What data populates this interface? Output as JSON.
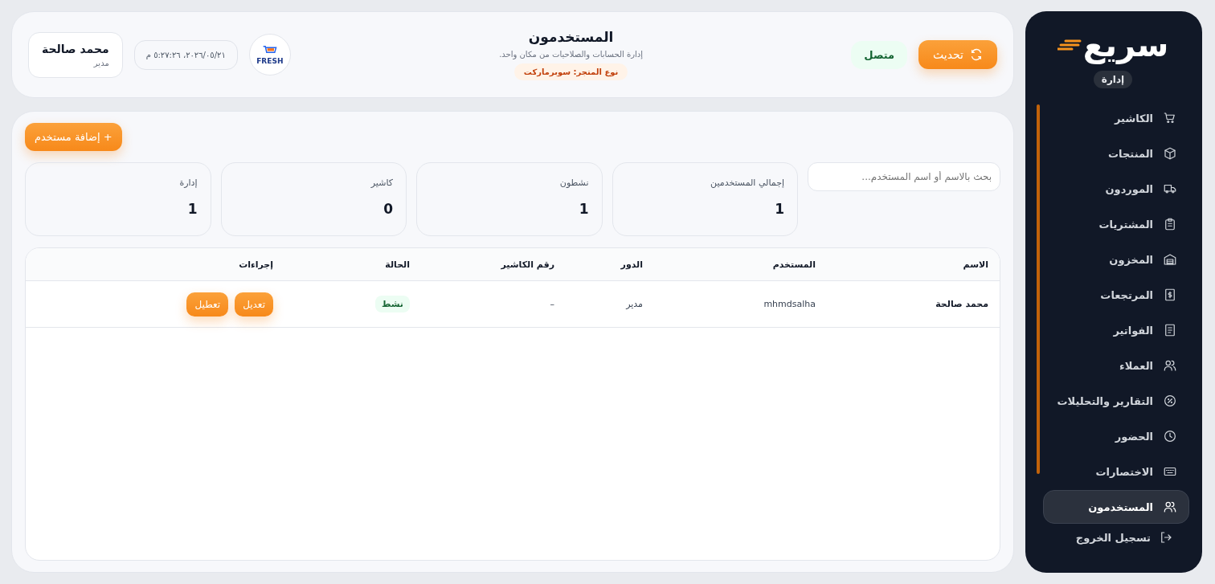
{
  "sidebar": {
    "logo": "سريع",
    "role_badge": "إدارة",
    "items": [
      {
        "label": "الكاشير",
        "selected": false
      },
      {
        "label": "المنتجات",
        "selected": false
      },
      {
        "label": "الموردون",
        "selected": false
      },
      {
        "label": "المشتريات",
        "selected": false
      },
      {
        "label": "المخزون",
        "selected": false
      },
      {
        "label": "المرتجعات",
        "selected": false
      },
      {
        "label": "الفواتير",
        "selected": false
      },
      {
        "label": "العملاء",
        "selected": false
      },
      {
        "label": "التقارير والتحليلات",
        "selected": false
      },
      {
        "label": "الحضور",
        "selected": false
      },
      {
        "label": "الاختصارات",
        "selected": false
      },
      {
        "label": "المستخدمون",
        "selected": true
      }
    ],
    "logout": "تسجيل الخروج"
  },
  "header": {
    "refresh_button": "تحديث",
    "connection": {
      "label": "متصل",
      "connected": true
    },
    "title": "المستخدمون",
    "subtitle": "إدارة الحسابات والصلاحيات من مكان واحد.",
    "store_type": "نوع المتجر: سوبرماركت",
    "store_logo": "FRESH",
    "datetime": "٢٠٢٦/٠٥/٢١، ٥:٢٧:٢٦ م",
    "user": {
      "name": "محمد صالحة",
      "role": "مدير"
    }
  },
  "add_button": "+ إضافة مستخدم",
  "search": {
    "placeholder": "بحث بالاسم أو اسم المستخدم..."
  },
  "stats": [
    {
      "label": "إجمالي المستخدمين",
      "value": "1"
    },
    {
      "label": "نشطون",
      "value": "1"
    },
    {
      "label": "كاشير",
      "value": "0"
    },
    {
      "label": "إدارة",
      "value": "1"
    }
  ],
  "table": {
    "columns": [
      "الاسم",
      "المستخدم",
      "الدور",
      "رقم الكاشير",
      "الحالة",
      "إجراءات"
    ],
    "rows": [
      {
        "name": "محمد صالحة",
        "username": "mhmdsalha",
        "role": "مدير",
        "cashier_no": "–",
        "status": {
          "label": "نشط",
          "kind": "active"
        },
        "actions": [
          "تعديل",
          "تعطيل"
        ]
      }
    ]
  }
}
